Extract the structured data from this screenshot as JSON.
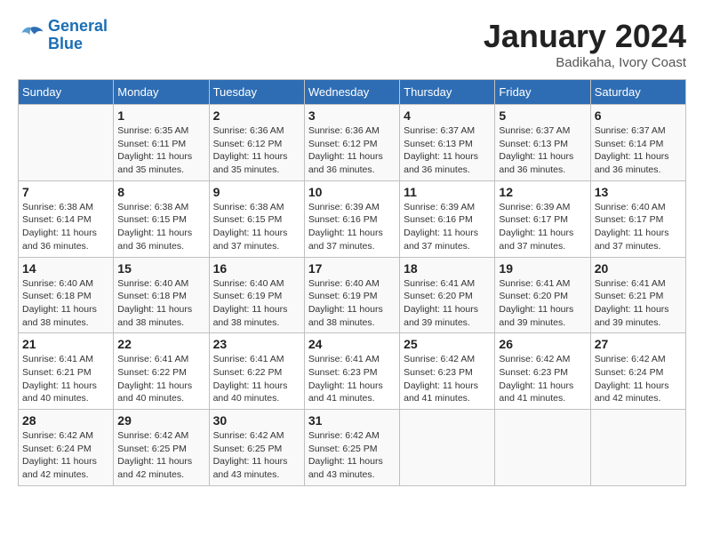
{
  "header": {
    "logo_line1": "General",
    "logo_line2": "Blue",
    "month": "January 2024",
    "location": "Badikaha, Ivory Coast"
  },
  "days_of_week": [
    "Sunday",
    "Monday",
    "Tuesday",
    "Wednesday",
    "Thursday",
    "Friday",
    "Saturday"
  ],
  "weeks": [
    [
      {
        "day": "",
        "info": ""
      },
      {
        "day": "1",
        "info": "Sunrise: 6:35 AM\nSunset: 6:11 PM\nDaylight: 11 hours\nand 35 minutes."
      },
      {
        "day": "2",
        "info": "Sunrise: 6:36 AM\nSunset: 6:12 PM\nDaylight: 11 hours\nand 35 minutes."
      },
      {
        "day": "3",
        "info": "Sunrise: 6:36 AM\nSunset: 6:12 PM\nDaylight: 11 hours\nand 36 minutes."
      },
      {
        "day": "4",
        "info": "Sunrise: 6:37 AM\nSunset: 6:13 PM\nDaylight: 11 hours\nand 36 minutes."
      },
      {
        "day": "5",
        "info": "Sunrise: 6:37 AM\nSunset: 6:13 PM\nDaylight: 11 hours\nand 36 minutes."
      },
      {
        "day": "6",
        "info": "Sunrise: 6:37 AM\nSunset: 6:14 PM\nDaylight: 11 hours\nand 36 minutes."
      }
    ],
    [
      {
        "day": "7",
        "info": "Sunrise: 6:38 AM\nSunset: 6:14 PM\nDaylight: 11 hours\nand 36 minutes."
      },
      {
        "day": "8",
        "info": "Sunrise: 6:38 AM\nSunset: 6:15 PM\nDaylight: 11 hours\nand 36 minutes."
      },
      {
        "day": "9",
        "info": "Sunrise: 6:38 AM\nSunset: 6:15 PM\nDaylight: 11 hours\nand 37 minutes."
      },
      {
        "day": "10",
        "info": "Sunrise: 6:39 AM\nSunset: 6:16 PM\nDaylight: 11 hours\nand 37 minutes."
      },
      {
        "day": "11",
        "info": "Sunrise: 6:39 AM\nSunset: 6:16 PM\nDaylight: 11 hours\nand 37 minutes."
      },
      {
        "day": "12",
        "info": "Sunrise: 6:39 AM\nSunset: 6:17 PM\nDaylight: 11 hours\nand 37 minutes."
      },
      {
        "day": "13",
        "info": "Sunrise: 6:40 AM\nSunset: 6:17 PM\nDaylight: 11 hours\nand 37 minutes."
      }
    ],
    [
      {
        "day": "14",
        "info": "Sunrise: 6:40 AM\nSunset: 6:18 PM\nDaylight: 11 hours\nand 38 minutes."
      },
      {
        "day": "15",
        "info": "Sunrise: 6:40 AM\nSunset: 6:18 PM\nDaylight: 11 hours\nand 38 minutes."
      },
      {
        "day": "16",
        "info": "Sunrise: 6:40 AM\nSunset: 6:19 PM\nDaylight: 11 hours\nand 38 minutes."
      },
      {
        "day": "17",
        "info": "Sunrise: 6:40 AM\nSunset: 6:19 PM\nDaylight: 11 hours\nand 38 minutes."
      },
      {
        "day": "18",
        "info": "Sunrise: 6:41 AM\nSunset: 6:20 PM\nDaylight: 11 hours\nand 39 minutes."
      },
      {
        "day": "19",
        "info": "Sunrise: 6:41 AM\nSunset: 6:20 PM\nDaylight: 11 hours\nand 39 minutes."
      },
      {
        "day": "20",
        "info": "Sunrise: 6:41 AM\nSunset: 6:21 PM\nDaylight: 11 hours\nand 39 minutes."
      }
    ],
    [
      {
        "day": "21",
        "info": "Sunrise: 6:41 AM\nSunset: 6:21 PM\nDaylight: 11 hours\nand 40 minutes."
      },
      {
        "day": "22",
        "info": "Sunrise: 6:41 AM\nSunset: 6:22 PM\nDaylight: 11 hours\nand 40 minutes."
      },
      {
        "day": "23",
        "info": "Sunrise: 6:41 AM\nSunset: 6:22 PM\nDaylight: 11 hours\nand 40 minutes."
      },
      {
        "day": "24",
        "info": "Sunrise: 6:41 AM\nSunset: 6:23 PM\nDaylight: 11 hours\nand 41 minutes."
      },
      {
        "day": "25",
        "info": "Sunrise: 6:42 AM\nSunset: 6:23 PM\nDaylight: 11 hours\nand 41 minutes."
      },
      {
        "day": "26",
        "info": "Sunrise: 6:42 AM\nSunset: 6:23 PM\nDaylight: 11 hours\nand 41 minutes."
      },
      {
        "day": "27",
        "info": "Sunrise: 6:42 AM\nSunset: 6:24 PM\nDaylight: 11 hours\nand 42 minutes."
      }
    ],
    [
      {
        "day": "28",
        "info": "Sunrise: 6:42 AM\nSunset: 6:24 PM\nDaylight: 11 hours\nand 42 minutes."
      },
      {
        "day": "29",
        "info": "Sunrise: 6:42 AM\nSunset: 6:25 PM\nDaylight: 11 hours\nand 42 minutes."
      },
      {
        "day": "30",
        "info": "Sunrise: 6:42 AM\nSunset: 6:25 PM\nDaylight: 11 hours\nand 43 minutes."
      },
      {
        "day": "31",
        "info": "Sunrise: 6:42 AM\nSunset: 6:25 PM\nDaylight: 11 hours\nand 43 minutes."
      },
      {
        "day": "",
        "info": ""
      },
      {
        "day": "",
        "info": ""
      },
      {
        "day": "",
        "info": ""
      }
    ]
  ]
}
